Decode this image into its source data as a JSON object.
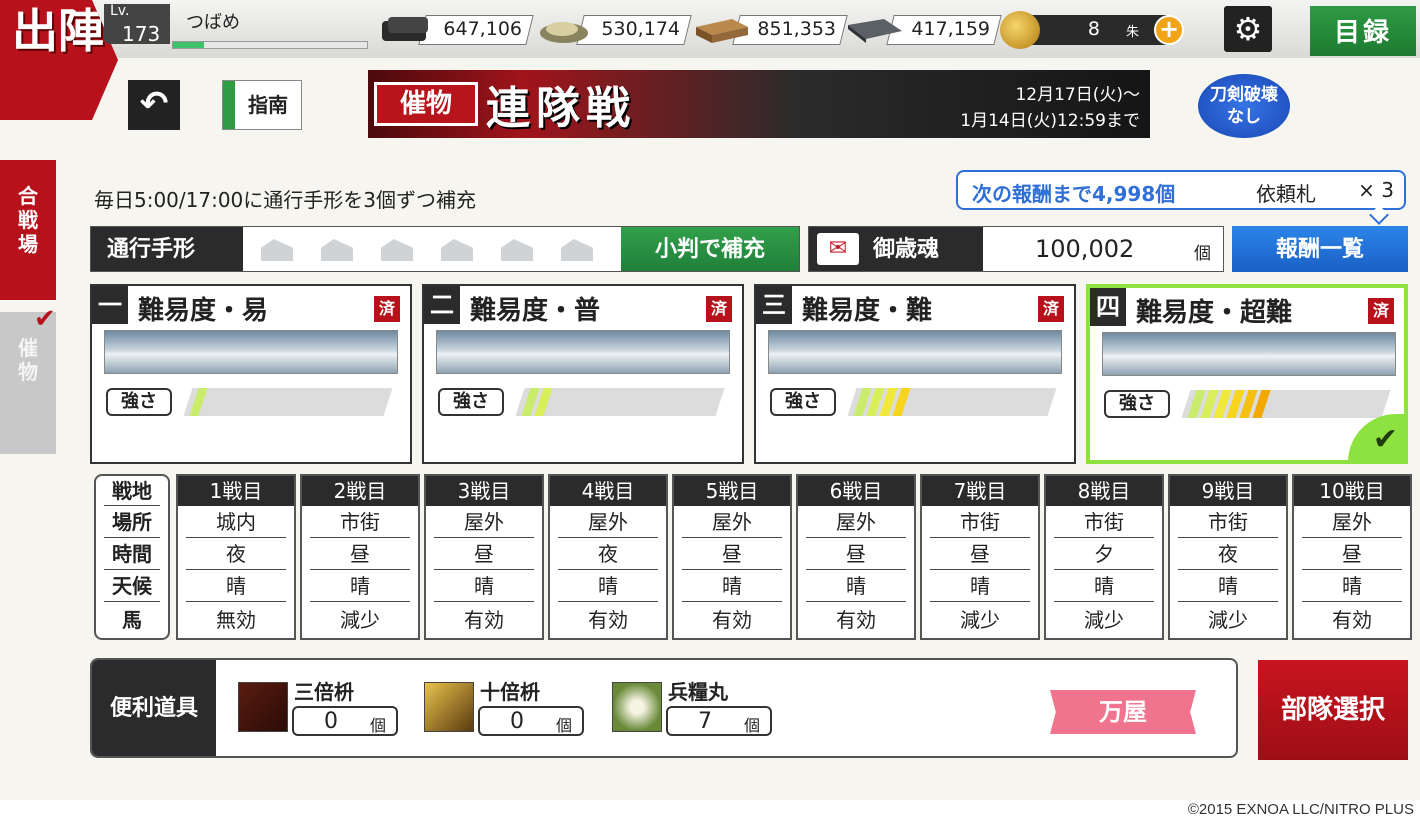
{
  "header": {
    "sortie_label": "出陣",
    "level_label": "Lv.",
    "level": "173",
    "player_name": "つばめ",
    "exp_fraction": 0.16,
    "resources": [
      {
        "icon": "charcoal-icon",
        "value": "647,106"
      },
      {
        "icon": "steel-icon",
        "value": "530,174"
      },
      {
        "icon": "coolant-icon",
        "value": "851,353"
      },
      {
        "icon": "whetstone-icon",
        "value": "417,159"
      }
    ],
    "koban_value": "8",
    "koban_unit": "朱",
    "catalog_label": "目録"
  },
  "subheader": {
    "guide_label": "指南",
    "event_tag": "催物",
    "event_title": "連隊戦",
    "date_start": "12月17日(火)～",
    "date_end": "1月14日(火)12:59まで",
    "no_break_line1": "刀剣破壊",
    "no_break_line2": "なし"
  },
  "side_tabs": [
    {
      "label": "合戦場"
    },
    {
      "label": "催物"
    }
  ],
  "refill_notice": "毎日5:00/17:00に通行手形を3個ずつ補充",
  "tooltip": {
    "next_reward": "次の報酬まで4,998個",
    "item": "依頼札",
    "count": "× 3"
  },
  "pass": {
    "label": "通行手形",
    "slots": 6,
    "refill_button": "小判で補充"
  },
  "saisai": {
    "label": "御歳魂",
    "value": "100,002",
    "unit": "個"
  },
  "reward_list_button": "報酬一覧",
  "difficulties": [
    {
      "num": "一",
      "title": "難易度・易",
      "done": "済",
      "strength_label": "強さ",
      "strength": 1,
      "selected": false
    },
    {
      "num": "二",
      "title": "難易度・普",
      "done": "済",
      "strength_label": "強さ",
      "strength": 2,
      "selected": false
    },
    {
      "num": "三",
      "title": "難易度・難",
      "done": "済",
      "strength_label": "強さ",
      "strength": 4,
      "selected": false
    },
    {
      "num": "四",
      "title": "難易度・超難",
      "done": "済",
      "strength_label": "強さ",
      "strength": 6,
      "selected": true
    }
  ],
  "battle_table": {
    "row_labels": [
      "戦地",
      "場所",
      "時間",
      "天候",
      "馬"
    ],
    "columns": [
      {
        "head": "1戦目",
        "place": "城内",
        "time": "夜",
        "weather": "晴",
        "horse": "無効"
      },
      {
        "head": "2戦目",
        "place": "市街",
        "time": "昼",
        "weather": "晴",
        "horse": "減少"
      },
      {
        "head": "3戦目",
        "place": "屋外",
        "time": "昼",
        "weather": "晴",
        "horse": "有効"
      },
      {
        "head": "4戦目",
        "place": "屋外",
        "time": "夜",
        "weather": "晴",
        "horse": "有効"
      },
      {
        "head": "5戦目",
        "place": "屋外",
        "time": "昼",
        "weather": "晴",
        "horse": "有効"
      },
      {
        "head": "6戦目",
        "place": "屋外",
        "time": "昼",
        "weather": "晴",
        "horse": "有効"
      },
      {
        "head": "7戦目",
        "place": "市街",
        "time": "昼",
        "weather": "晴",
        "horse": "減少"
      },
      {
        "head": "8戦目",
        "place": "市街",
        "time": "夕",
        "weather": "晴",
        "horse": "減少"
      },
      {
        "head": "9戦目",
        "place": "市街",
        "time": "夜",
        "weather": "晴",
        "horse": "減少"
      },
      {
        "head": "10戦目",
        "place": "屋外",
        "time": "昼",
        "weather": "晴",
        "horse": "有効"
      }
    ]
  },
  "items": {
    "label": "便利道具",
    "list": [
      {
        "name": "三倍枡",
        "count": "0",
        "unit": "個"
      },
      {
        "name": "十倍枡",
        "count": "0",
        "unit": "個"
      },
      {
        "name": "兵糧丸",
        "count": "7",
        "unit": "個"
      }
    ],
    "shop_label": "万屋"
  },
  "unit_select_button": "部隊選択",
  "copyright": "©2015 EXNOA LLC/NITRO PLUS",
  "colors": {
    "brand_red": "#b7121b",
    "green": "#2f9b44",
    "blue": "#1a5fc6",
    "selected_border": "#8ee23f"
  }
}
